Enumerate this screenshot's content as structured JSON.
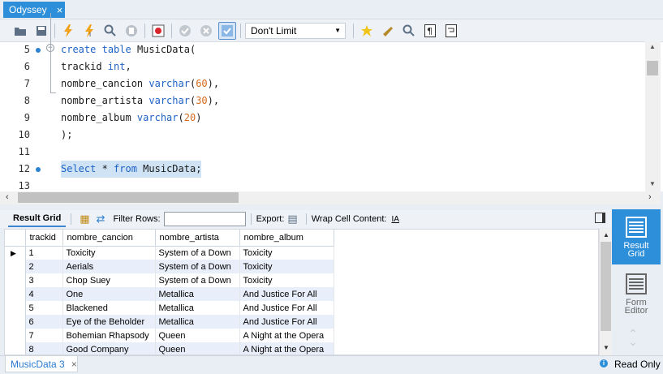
{
  "window": {
    "tab_title": "Odyssey",
    "tab_close": "×"
  },
  "toolbar": {
    "limit_value": "Don't Limit",
    "icons": [
      "open-folder-icon",
      "save-icon",
      "execute-icon",
      "execute-current-icon",
      "explain-icon",
      "stop-icon",
      "toggle-error-icon",
      "commit-icon",
      "rollback-icon",
      "autocommit-icon",
      "bookmark-icon",
      "beautify-icon",
      "find-icon",
      "invisible-chars-icon",
      "wrap-icon"
    ]
  },
  "editor": {
    "lines": [
      {
        "number": "5",
        "bp": true,
        "fold": true,
        "tokens": [
          [
            "kw",
            "create"
          ],
          [
            "t",
            " "
          ],
          [
            "kw",
            "table"
          ],
          [
            "t",
            " MusicData("
          ]
        ]
      },
      {
        "number": "6",
        "bp": false,
        "fold": false,
        "tokens": [
          [
            "t",
            "trackid "
          ],
          [
            "kw",
            "int"
          ],
          [
            "t",
            ","
          ]
        ]
      },
      {
        "number": "7",
        "bp": false,
        "fold": false,
        "tokens": [
          [
            "t",
            "nombre_cancion "
          ],
          [
            "kw",
            "varchar"
          ],
          [
            "t",
            "("
          ],
          [
            "num",
            "60"
          ],
          [
            "t",
            "),"
          ]
        ]
      },
      {
        "number": "8",
        "bp": false,
        "fold": false,
        "tokens": [
          [
            "t",
            "nombre_artista "
          ],
          [
            "kw",
            "varchar"
          ],
          [
            "t",
            "("
          ],
          [
            "num",
            "30"
          ],
          [
            "t",
            "),"
          ]
        ]
      },
      {
        "number": "9",
        "bp": false,
        "fold": false,
        "tokens": [
          [
            "t",
            "nombre_album "
          ],
          [
            "kw",
            "varchar"
          ],
          [
            "t",
            "("
          ],
          [
            "num",
            "20"
          ],
          [
            "t",
            ")"
          ]
        ]
      },
      {
        "number": "10",
        "bp": false,
        "fold": false,
        "tokens": [
          [
            "t",
            ");"
          ]
        ]
      },
      {
        "number": "11",
        "bp": false,
        "fold": false,
        "tokens": []
      },
      {
        "number": "12",
        "bp": true,
        "fold": false,
        "selected": true,
        "tokens": [
          [
            "kw",
            "Select"
          ],
          [
            "t",
            " * "
          ],
          [
            "kw",
            "from"
          ],
          [
            "t",
            " MusicData;"
          ]
        ]
      },
      {
        "number": "13",
        "bp": false,
        "fold": false,
        "tokens": []
      }
    ]
  },
  "result_bar": {
    "result_grid_label": "Result Grid",
    "filter_label": "Filter Rows:",
    "filter_value": "",
    "export_label": "Export:",
    "wrap_label": "Wrap Cell Content:",
    "wrap_icon_text": "IA"
  },
  "grid": {
    "columns": [
      "trackid",
      "nombre_cancion",
      "nombre_artista",
      "nombre_album"
    ],
    "rows": [
      [
        "1",
        "Toxicity",
        "System of a Down",
        "Toxicity"
      ],
      [
        "2",
        "Aerials",
        "System of a Down",
        "Toxicity"
      ],
      [
        "3",
        "Chop Suey",
        "System of a Down",
        "Toxicity"
      ],
      [
        "4",
        "One",
        "Metallica",
        "And Justice For All"
      ],
      [
        "5",
        "Blackened",
        "Metallica",
        "And Justice For All"
      ],
      [
        "6",
        "Eye of the Beholder",
        "Metallica",
        "And Justice For All"
      ],
      [
        "7",
        "Bohemian Rhapsody",
        "Queen",
        "A Night at the Opera"
      ],
      [
        "8",
        "Good Company",
        "Queen",
        "A Night at the Opera"
      ]
    ],
    "current_row": 0
  },
  "side_panel": {
    "result_grid_label": "Result Grid",
    "form_editor_label": "Form Editor"
  },
  "status": {
    "result_tab_label": "MusicData 3",
    "result_tab_close": "×",
    "mode": "Read Only"
  },
  "colors": {
    "accent": "#2d8fd9",
    "keyword": "#1e63c6",
    "number": "#d46b1f",
    "selection": "#cfe3f5",
    "alt_row": "#e9effa"
  }
}
